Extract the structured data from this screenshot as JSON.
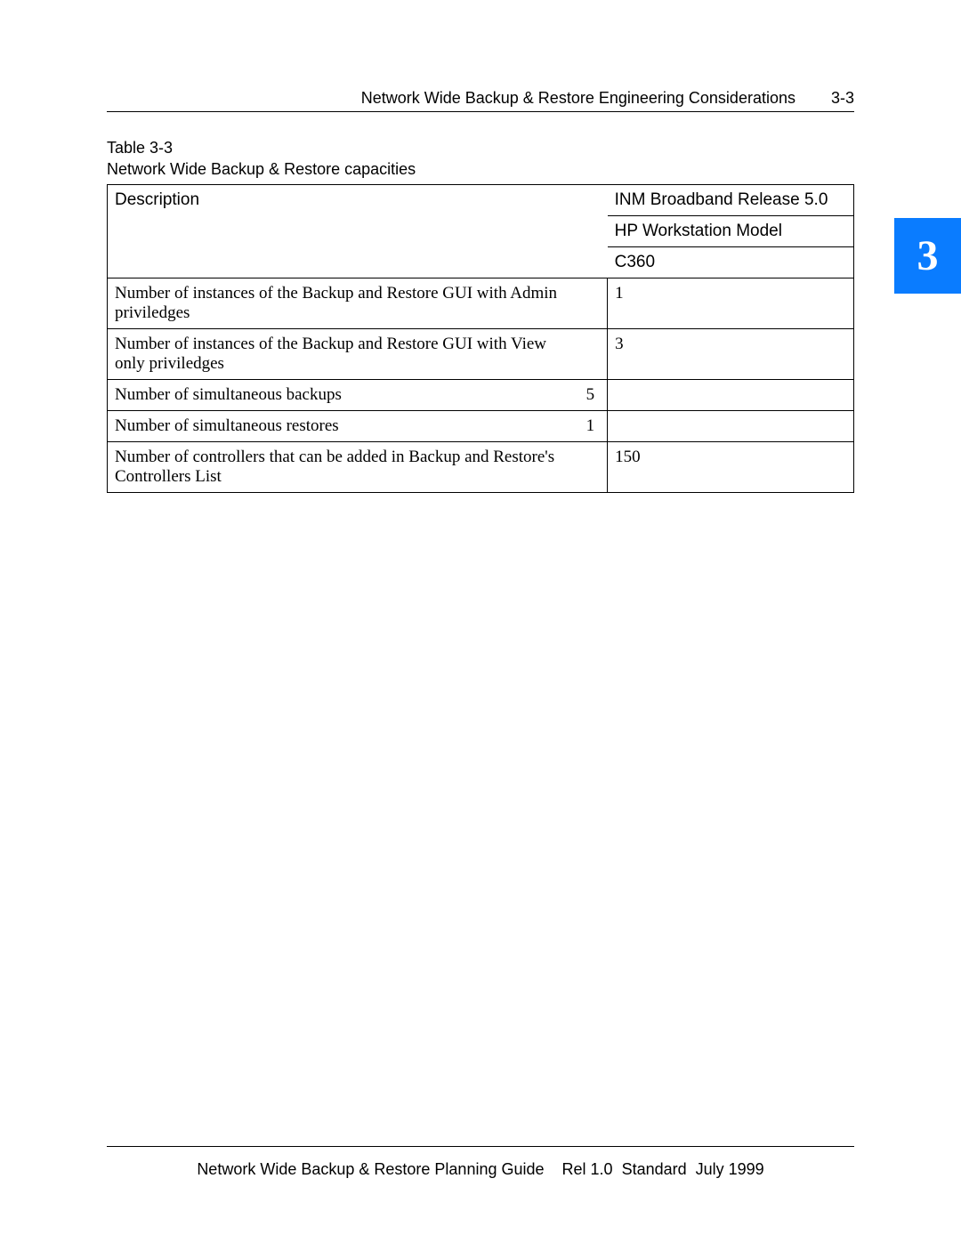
{
  "header": {
    "title": "Network Wide Backup & Restore Engineering Considerations",
    "page_number": "3-3"
  },
  "side_tab": "3",
  "table": {
    "label_line1": "Table 3-3",
    "label_line2": "Network Wide Backup & Restore capacities",
    "head": {
      "desc": "Description",
      "col_line1": "INM Broadband Release 5.0",
      "col_line2": "HP Workstation Model",
      "col_line3": "C360"
    },
    "rows": [
      {
        "desc": "Number of instances of the Backup and Restore GUI with Admin priviledges",
        "mid": "",
        "val": "1"
      },
      {
        "desc": "Number of instances of the Backup and Restore GUI with View only priviledges",
        "mid": "",
        "val": "3"
      },
      {
        "desc": "Number of simultaneous backups",
        "mid": "5",
        "val": ""
      },
      {
        "desc": "Number of simultaneous restores",
        "mid": "1",
        "val": ""
      },
      {
        "desc": "Number of controllers that can be added in Backup and Restore's Controllers List",
        "mid": "",
        "val": "150"
      }
    ]
  },
  "footer": {
    "doc": "Network Wide Backup & Restore Planning Guide",
    "rel": "Rel 1.0",
    "std": "Standard",
    "date": "July 1999"
  }
}
